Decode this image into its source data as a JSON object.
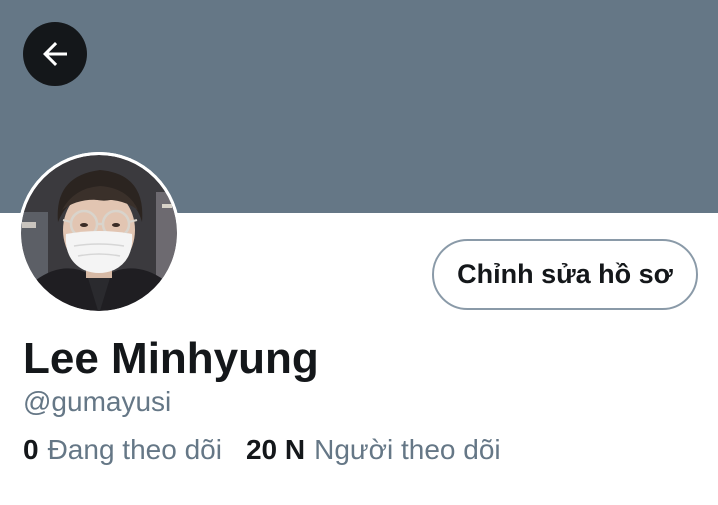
{
  "header": {
    "banner_color": "#657786",
    "back_icon": "arrow-left-icon"
  },
  "profile": {
    "display_name": "Lee Minhyung",
    "handle": "@gumayusi",
    "edit_button_label": "Chỉnh sửa hồ sơ",
    "avatar": "avatar-photo"
  },
  "stats": {
    "following_count": "0",
    "following_label": "Đang theo dõi",
    "followers_count": "20 N",
    "followers_label": "Người theo dõi"
  }
}
